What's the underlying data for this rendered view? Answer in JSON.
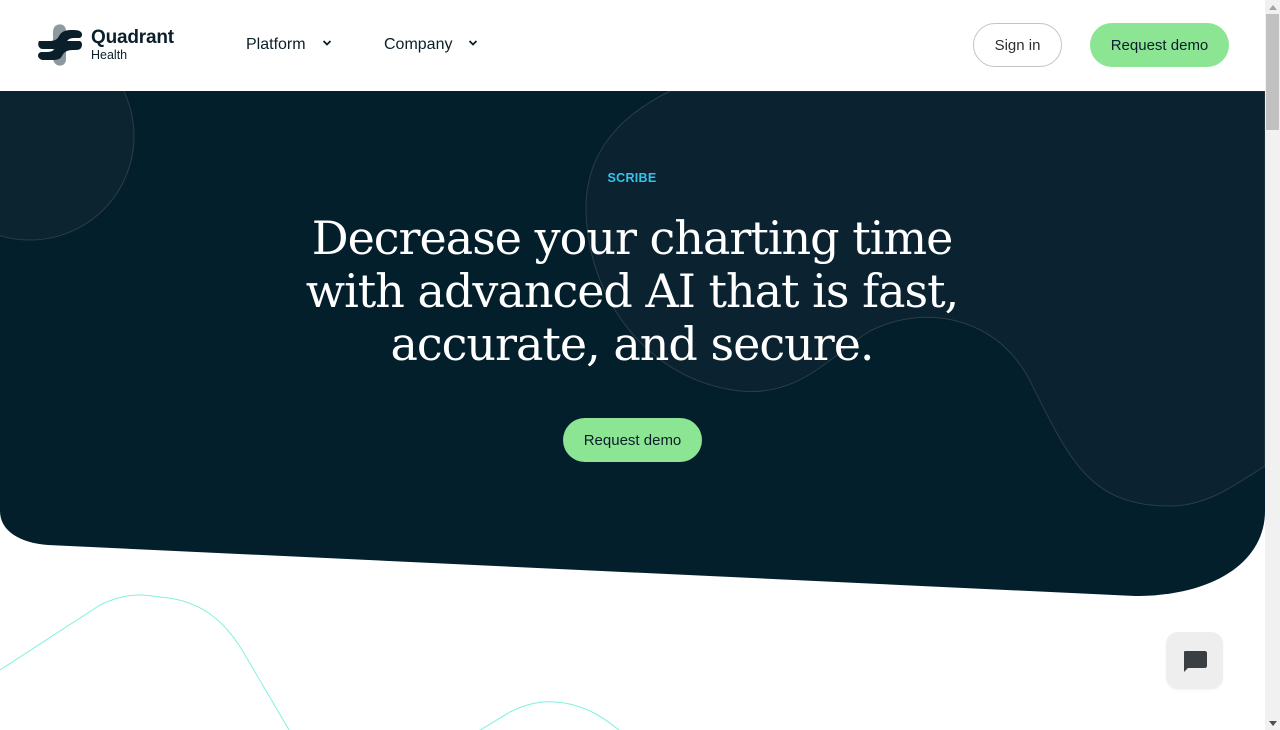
{
  "brand": {
    "name": "Quadrant",
    "sub": "Health"
  },
  "nav": {
    "items": [
      {
        "label": "Platform",
        "icon": "chevron-down-icon"
      },
      {
        "label": "Company",
        "icon": "chevron-down-icon"
      }
    ],
    "sign_in_label": "Sign in",
    "request_demo_label": "Request demo"
  },
  "hero": {
    "badge": "SCRIBE",
    "headline_lines": [
      "Decrease your charting time",
      "with advanced AI that is fast,",
      "accurate, and secure."
    ],
    "cta_label": "Request demo"
  },
  "chat": {
    "icon": "chat-bubble-icon"
  },
  "colors": {
    "hero_bg": "#031f2b",
    "accent_green": "#8be592",
    "badge_text": "#33c3ee",
    "brand_dark": "#0b1f2a",
    "line_cyan": "#7ff0e0"
  }
}
